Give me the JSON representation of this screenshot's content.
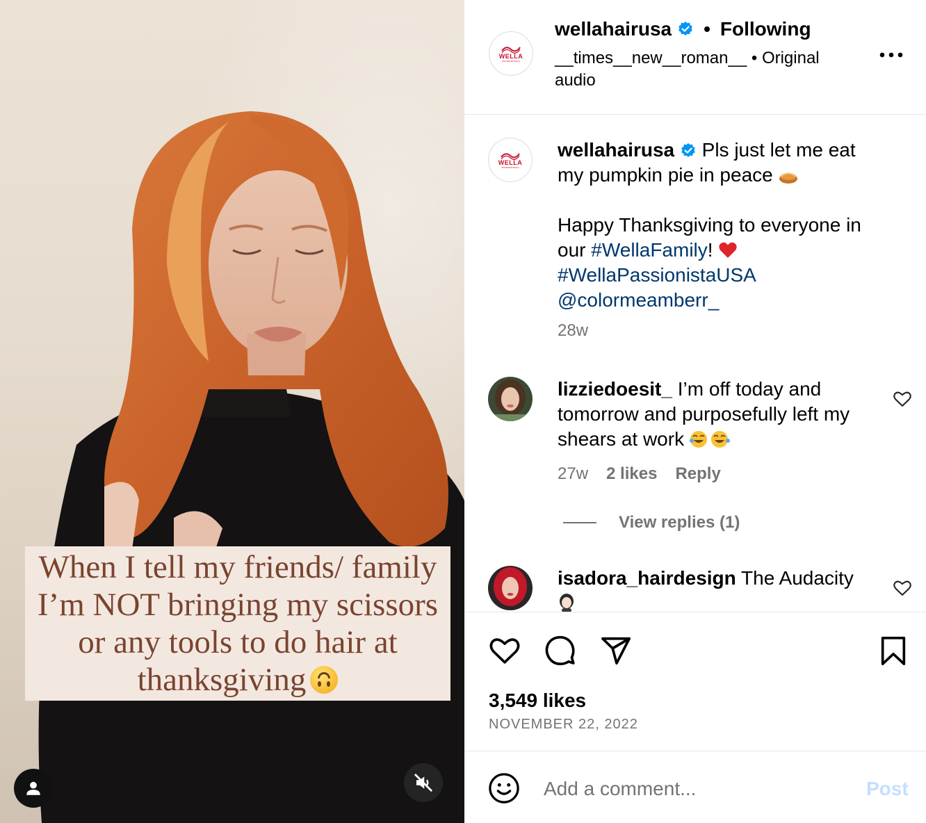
{
  "video": {
    "overlay_text": "When  I tell my friends/ family I’m NOT bringing my scissors or any tools to do hair at thanksgiving",
    "overlay_emoji": "upside-down-face-emoji",
    "user_icon": "user-icon",
    "mute_icon": "muted-speaker-icon"
  },
  "header": {
    "username": "wellahairusa",
    "follow_status": "Following",
    "audio_user": "__times__new__roman__",
    "audio_label": "Original audio",
    "more_icon": "more-options-icon",
    "avatar_brand": "WELLA",
    "avatar_sub": "PROFESSIONALS"
  },
  "caption": {
    "username": "wellahairusa",
    "text_line1": "Pls just let me eat my pumpkin pie in peace",
    "text_line2_pre": "Happy Thanksgiving to everyone in our",
    "hashtag1": "#WellaFamily",
    "text_after_tag": "!",
    "hashtag2": "#WellaPassionistaUSA",
    "mention": "@colormeamberr_",
    "time": "28w"
  },
  "comments": [
    {
      "username": "lizziedoesit_",
      "text": "I’m off today and tomorrow and purposefully left my shears at work",
      "time": "27w",
      "likes": "2 likes",
      "reply": "Reply",
      "view_replies": "View replies (1)"
    },
    {
      "username": "isadora_hairdesign",
      "text": "The Audacity"
    }
  ],
  "actions": {
    "likes": "3,549 likes",
    "date": "NOVEMBER 22, 2022"
  },
  "comment_box": {
    "placeholder": "Add a comment...",
    "post_label": "Post"
  },
  "colors": {
    "link": "#00376b",
    "muted": "#737373",
    "verified": "#0095f6",
    "post_disabled": "#c3dffe",
    "overlay_text": "#7a4430"
  }
}
